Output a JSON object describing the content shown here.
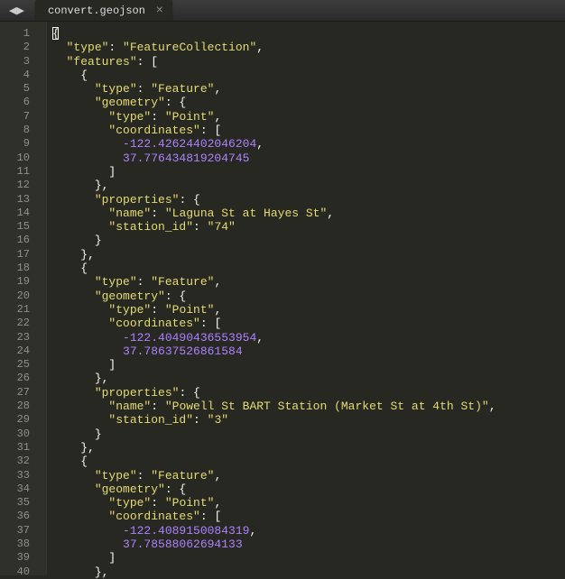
{
  "titlebar": {
    "nav_left": "◀",
    "nav_right": "▶"
  },
  "tab": {
    "filename": "convert.geojson",
    "close": "×"
  },
  "gutter": {
    "from": 1,
    "to": 40
  },
  "code_lines": [
    {
      "indent": 0,
      "tokens": [
        {
          "t": "cursor"
        },
        {
          "t": "p",
          "v": "{"
        }
      ]
    },
    {
      "indent": 1,
      "tokens": [
        {
          "t": "s",
          "v": "\"type\""
        },
        {
          "t": "p",
          "v": ": "
        },
        {
          "t": "s",
          "v": "\"FeatureCollection\""
        },
        {
          "t": "p",
          "v": ","
        }
      ]
    },
    {
      "indent": 1,
      "tokens": [
        {
          "t": "s",
          "v": "\"features\""
        },
        {
          "t": "p",
          "v": ": ["
        }
      ]
    },
    {
      "indent": 2,
      "tokens": [
        {
          "t": "p",
          "v": "{"
        }
      ]
    },
    {
      "indent": 3,
      "tokens": [
        {
          "t": "s",
          "v": "\"type\""
        },
        {
          "t": "p",
          "v": ": "
        },
        {
          "t": "s",
          "v": "\"Feature\""
        },
        {
          "t": "p",
          "v": ","
        }
      ]
    },
    {
      "indent": 3,
      "tokens": [
        {
          "t": "s",
          "v": "\"geometry\""
        },
        {
          "t": "p",
          "v": ": {"
        }
      ]
    },
    {
      "indent": 4,
      "tokens": [
        {
          "t": "s",
          "v": "\"type\""
        },
        {
          "t": "p",
          "v": ": "
        },
        {
          "t": "s",
          "v": "\"Point\""
        },
        {
          "t": "p",
          "v": ","
        }
      ]
    },
    {
      "indent": 4,
      "tokens": [
        {
          "t": "s",
          "v": "\"coordinates\""
        },
        {
          "t": "p",
          "v": ": ["
        }
      ]
    },
    {
      "indent": 5,
      "tokens": [
        {
          "t": "n",
          "v": "-122.42624402046204"
        },
        {
          "t": "p",
          "v": ","
        }
      ]
    },
    {
      "indent": 5,
      "tokens": [
        {
          "t": "n",
          "v": "37.776434819204745"
        }
      ]
    },
    {
      "indent": 4,
      "tokens": [
        {
          "t": "p",
          "v": "]"
        }
      ]
    },
    {
      "indent": 3,
      "tokens": [
        {
          "t": "p",
          "v": "},"
        }
      ]
    },
    {
      "indent": 3,
      "tokens": [
        {
          "t": "s",
          "v": "\"properties\""
        },
        {
          "t": "p",
          "v": ": {"
        }
      ]
    },
    {
      "indent": 4,
      "tokens": [
        {
          "t": "s",
          "v": "\"name\""
        },
        {
          "t": "p",
          "v": ": "
        },
        {
          "t": "s",
          "v": "\"Laguna St at Hayes St\""
        },
        {
          "t": "p",
          "v": ","
        }
      ]
    },
    {
      "indent": 4,
      "tokens": [
        {
          "t": "s",
          "v": "\"station_id\""
        },
        {
          "t": "p",
          "v": ": "
        },
        {
          "t": "s",
          "v": "\"74\""
        }
      ]
    },
    {
      "indent": 3,
      "tokens": [
        {
          "t": "p",
          "v": "}"
        }
      ]
    },
    {
      "indent": 2,
      "tokens": [
        {
          "t": "p",
          "v": "},"
        }
      ]
    },
    {
      "indent": 2,
      "tokens": [
        {
          "t": "p",
          "v": "{"
        }
      ]
    },
    {
      "indent": 3,
      "tokens": [
        {
          "t": "s",
          "v": "\"type\""
        },
        {
          "t": "p",
          "v": ": "
        },
        {
          "t": "s",
          "v": "\"Feature\""
        },
        {
          "t": "p",
          "v": ","
        }
      ]
    },
    {
      "indent": 3,
      "tokens": [
        {
          "t": "s",
          "v": "\"geometry\""
        },
        {
          "t": "p",
          "v": ": {"
        }
      ]
    },
    {
      "indent": 4,
      "tokens": [
        {
          "t": "s",
          "v": "\"type\""
        },
        {
          "t": "p",
          "v": ": "
        },
        {
          "t": "s",
          "v": "\"Point\""
        },
        {
          "t": "p",
          "v": ","
        }
      ]
    },
    {
      "indent": 4,
      "tokens": [
        {
          "t": "s",
          "v": "\"coordinates\""
        },
        {
          "t": "p",
          "v": ": ["
        }
      ]
    },
    {
      "indent": 5,
      "tokens": [
        {
          "t": "n",
          "v": "-122.40490436553954"
        },
        {
          "t": "p",
          "v": ","
        }
      ]
    },
    {
      "indent": 5,
      "tokens": [
        {
          "t": "n",
          "v": "37.78637526861584"
        }
      ]
    },
    {
      "indent": 4,
      "tokens": [
        {
          "t": "p",
          "v": "]"
        }
      ]
    },
    {
      "indent": 3,
      "tokens": [
        {
          "t": "p",
          "v": "},"
        }
      ]
    },
    {
      "indent": 3,
      "tokens": [
        {
          "t": "s",
          "v": "\"properties\""
        },
        {
          "t": "p",
          "v": ": {"
        }
      ]
    },
    {
      "indent": 4,
      "tokens": [
        {
          "t": "s",
          "v": "\"name\""
        },
        {
          "t": "p",
          "v": ": "
        },
        {
          "t": "s",
          "v": "\"Powell St BART Station (Market St at 4th St)\""
        },
        {
          "t": "p",
          "v": ","
        }
      ]
    },
    {
      "indent": 4,
      "tokens": [
        {
          "t": "s",
          "v": "\"station_id\""
        },
        {
          "t": "p",
          "v": ": "
        },
        {
          "t": "s",
          "v": "\"3\""
        }
      ]
    },
    {
      "indent": 3,
      "tokens": [
        {
          "t": "p",
          "v": "}"
        }
      ]
    },
    {
      "indent": 2,
      "tokens": [
        {
          "t": "p",
          "v": "},"
        }
      ]
    },
    {
      "indent": 2,
      "tokens": [
        {
          "t": "p",
          "v": "{"
        }
      ]
    },
    {
      "indent": 3,
      "tokens": [
        {
          "t": "s",
          "v": "\"type\""
        },
        {
          "t": "p",
          "v": ": "
        },
        {
          "t": "s",
          "v": "\"Feature\""
        },
        {
          "t": "p",
          "v": ","
        }
      ]
    },
    {
      "indent": 3,
      "tokens": [
        {
          "t": "s",
          "v": "\"geometry\""
        },
        {
          "t": "p",
          "v": ": {"
        }
      ]
    },
    {
      "indent": 4,
      "tokens": [
        {
          "t": "s",
          "v": "\"type\""
        },
        {
          "t": "p",
          "v": ": "
        },
        {
          "t": "s",
          "v": "\"Point\""
        },
        {
          "t": "p",
          "v": ","
        }
      ]
    },
    {
      "indent": 4,
      "tokens": [
        {
          "t": "s",
          "v": "\"coordinates\""
        },
        {
          "t": "p",
          "v": ": ["
        }
      ]
    },
    {
      "indent": 5,
      "tokens": [
        {
          "t": "n",
          "v": "-122.4089150084319"
        },
        {
          "t": "p",
          "v": ","
        }
      ]
    },
    {
      "indent": 5,
      "tokens": [
        {
          "t": "n",
          "v": "37.78588062694133"
        }
      ]
    },
    {
      "indent": 4,
      "tokens": [
        {
          "t": "p",
          "v": "]"
        }
      ]
    },
    {
      "indent": 3,
      "tokens": [
        {
          "t": "p",
          "v": "},"
        }
      ]
    }
  ]
}
